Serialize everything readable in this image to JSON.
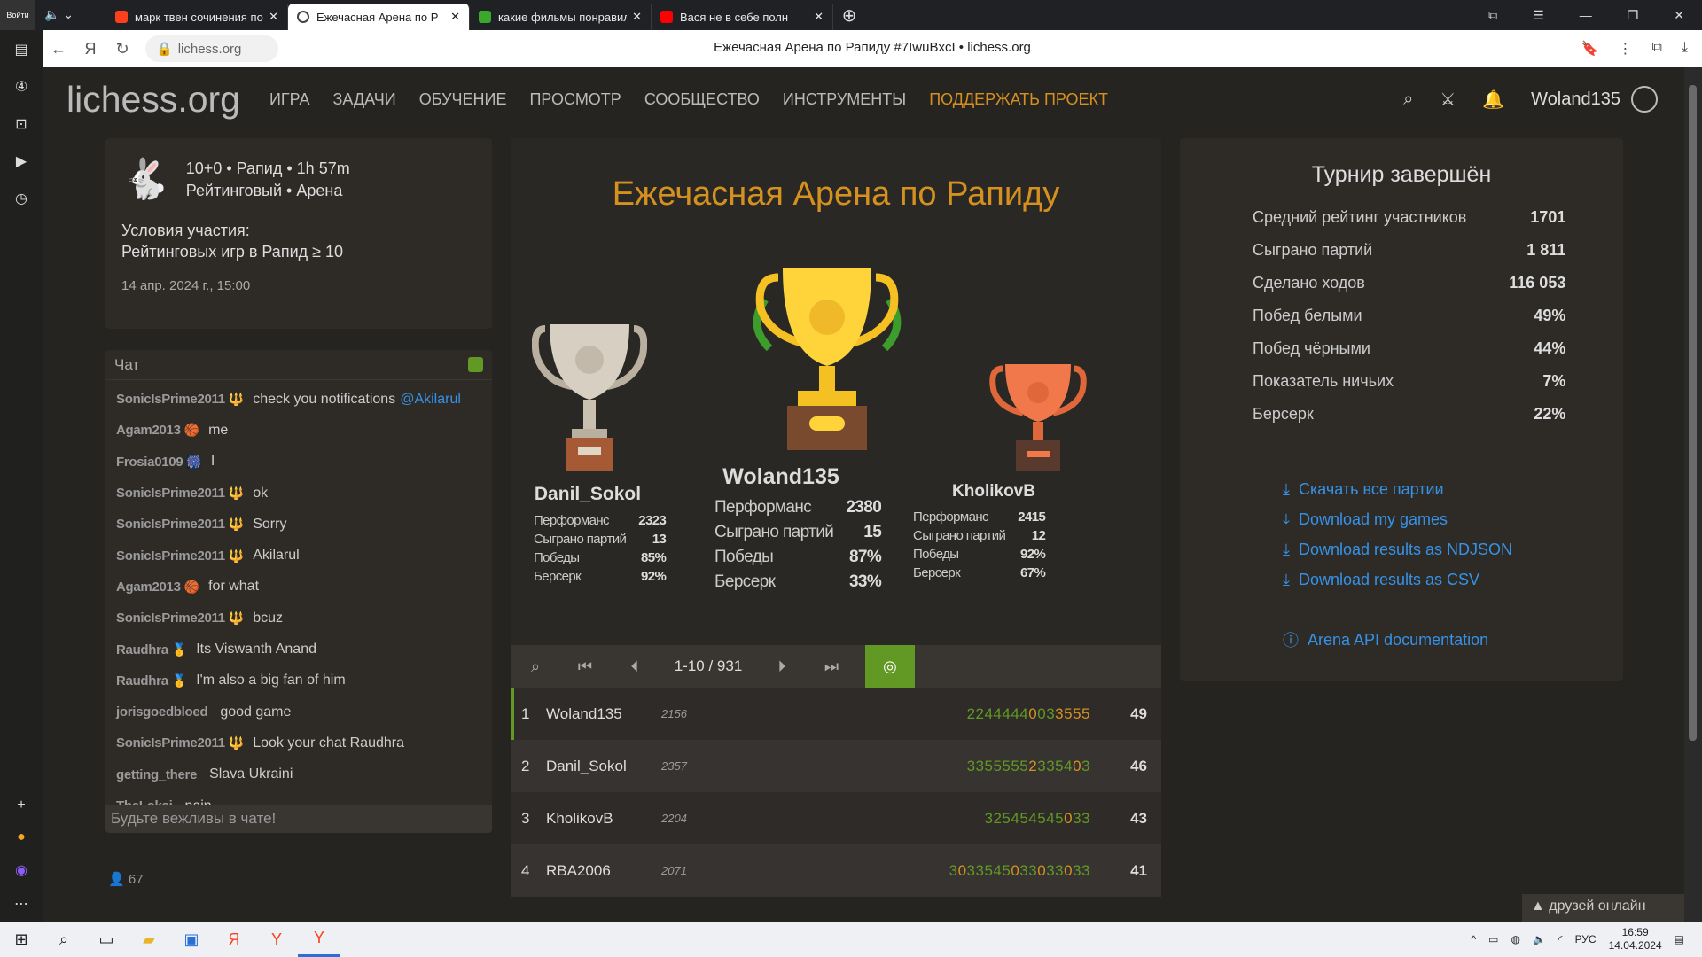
{
  "browser": {
    "tabs": [
      {
        "title": "марк твен сочинения по"
      },
      {
        "title": "Ежечасная Арена по Р"
      },
      {
        "title": "какие фильмы понравили"
      },
      {
        "title": "Вася не в себе полн"
      }
    ],
    "url": "lichess.org",
    "page_title": "Ежечасная Арена по Рапиду #7IwuBxcI • lichess.org",
    "login_label": "Войти"
  },
  "header": {
    "logo": "lichess.org",
    "nav": [
      "ИГРА",
      "ЗАДАЧИ",
      "ОБУЧЕНИЕ",
      "ПРОСМОТР",
      "СООБЩЕСТВО",
      "ИНСТРУМЕНТЫ"
    ],
    "donate": "ПОДДЕРЖАТЬ ПРОЕКТ",
    "username": "Woland135"
  },
  "info": {
    "line1": "10+0 • Рапид • 1h 57m",
    "line2": "Рейтинговый • Арена",
    "cond_title": "Условия участия:",
    "cond_text": "Рейтинговых игр в Рапид ≥ 10",
    "date": "14 апр. 2024 г., 15:00"
  },
  "chat": {
    "title": "Чат",
    "messages": [
      {
        "user": "SonicIsPrime2011",
        "flair": "🔱",
        "text": "check you notifications",
        "mention": "@Akilarul"
      },
      {
        "user": "Agam2013",
        "flair": "🏀",
        "text": "me",
        "mention": ""
      },
      {
        "user": "Frosia0109",
        "flair": "🎆",
        "text": "I",
        "mention": ""
      },
      {
        "user": "SonicIsPrime2011",
        "flair": "🔱",
        "text": "ok",
        "mention": ""
      },
      {
        "user": "SonicIsPrime2011",
        "flair": "🔱",
        "text": "Sorry",
        "mention": ""
      },
      {
        "user": "SonicIsPrime2011",
        "flair": "🔱",
        "text": "Akilarul",
        "mention": ""
      },
      {
        "user": "Agam2013",
        "flair": "🏀",
        "text": "for what",
        "mention": ""
      },
      {
        "user": "SonicIsPrime2011",
        "flair": "🔱",
        "text": "bcuz",
        "mention": ""
      },
      {
        "user": "Raudhra",
        "flair": "🥇",
        "text": "Its Viswanth Anand",
        "mention": ""
      },
      {
        "user": "Raudhra",
        "flair": "🥇",
        "text": "I'm also a big fan of him",
        "mention": ""
      },
      {
        "user": "jorisgoedbloed",
        "flair": "",
        "text": "good game",
        "mention": ""
      },
      {
        "user": "SonicIsPrime2011",
        "flair": "🔱",
        "text": "Look your chat Raudhra",
        "mention": ""
      },
      {
        "user": "getting_there",
        "flair": "",
        "text": "Slava Ukraini",
        "mention": ""
      },
      {
        "user": "TheLoksi",
        "flair": "",
        "text": "nain",
        "mention": ""
      }
    ],
    "placeholder": "Будьте вежливы в чате!",
    "online": "67"
  },
  "tournament": {
    "title": "Ежечасная Арена по Рапиду",
    "stat_labels": [
      "Перформанс",
      "Сыграно партий",
      "Победы",
      "Берсерк"
    ],
    "podium": [
      {
        "place": 2,
        "name": "Danil_Sokol",
        "values": [
          "2323",
          "13",
          "85%",
          "92%"
        ]
      },
      {
        "place": 1,
        "name": "Woland135",
        "values": [
          "2380",
          "15",
          "87%",
          "33%"
        ]
      },
      {
        "place": 3,
        "name": "KholikovB",
        "values": [
          "2415",
          "12",
          "92%",
          "67%"
        ]
      }
    ],
    "pager": "1-10 / 931",
    "standings": [
      {
        "rank": "1",
        "name": "Woland135",
        "rating": "2156",
        "scores": [
          {
            "d": "2244444",
            "c": "g"
          },
          {
            "d": "0",
            "c": "o"
          },
          {
            "d": "0",
            "c": "g"
          },
          {
            "d": "3",
            "c": "g"
          },
          {
            "d": "3",
            "c": "o"
          },
          {
            "d": "555",
            "c": "o"
          }
        ],
        "total": "49"
      },
      {
        "rank": "2",
        "name": "Danil_Sokol",
        "rating": "2357",
        "scores": [
          {
            "d": "3355555",
            "c": "g"
          },
          {
            "d": "2",
            "c": "o"
          },
          {
            "d": "3354",
            "c": "g"
          },
          {
            "d": "0",
            "c": "o"
          },
          {
            "d": "3",
            "c": "g"
          }
        ],
        "total": "46"
      },
      {
        "rank": "3",
        "name": "KholikovB",
        "rating": "2204",
        "scores": [
          {
            "d": "325454545",
            "c": "g"
          },
          {
            "d": "0",
            "c": "o"
          },
          {
            "d": "33",
            "c": "g"
          }
        ],
        "total": "43"
      },
      {
        "rank": "4",
        "name": "RBA2006",
        "rating": "2071",
        "scores": [
          {
            "d": "3",
            "c": "g"
          },
          {
            "d": "0",
            "c": "o"
          },
          {
            "d": "33545",
            "c": "g"
          },
          {
            "d": "0",
            "c": "o"
          },
          {
            "d": "33",
            "c": "g"
          },
          {
            "d": "0",
            "c": "o"
          },
          {
            "d": "33",
            "c": "g"
          },
          {
            "d": "0",
            "c": "o"
          },
          {
            "d": "33",
            "c": "g"
          }
        ],
        "total": "41"
      }
    ]
  },
  "summary": {
    "title": "Турнир завершён",
    "rows": [
      {
        "label": "Средний рейтинг участников",
        "value": "1701"
      },
      {
        "label": "Сыграно партий",
        "value": "1 811"
      },
      {
        "label": "Сделано ходов",
        "value": "116 053"
      },
      {
        "label": "Побед белыми",
        "value": "49%"
      },
      {
        "label": "Побед чёрными",
        "value": "44%"
      },
      {
        "label": "Показатель ничьих",
        "value": "7%"
      },
      {
        "label": "Берсерк",
        "value": "22%"
      }
    ],
    "links": [
      "Скачать все партии",
      "Download my games",
      "Download results as NDJSON",
      "Download results as CSV"
    ],
    "api_link": "Arena API documentation"
  },
  "friends_label": "друзей онлайн",
  "taskbar": {
    "lang": "РУС",
    "time": "16:59",
    "date": "14.04.2024"
  }
}
